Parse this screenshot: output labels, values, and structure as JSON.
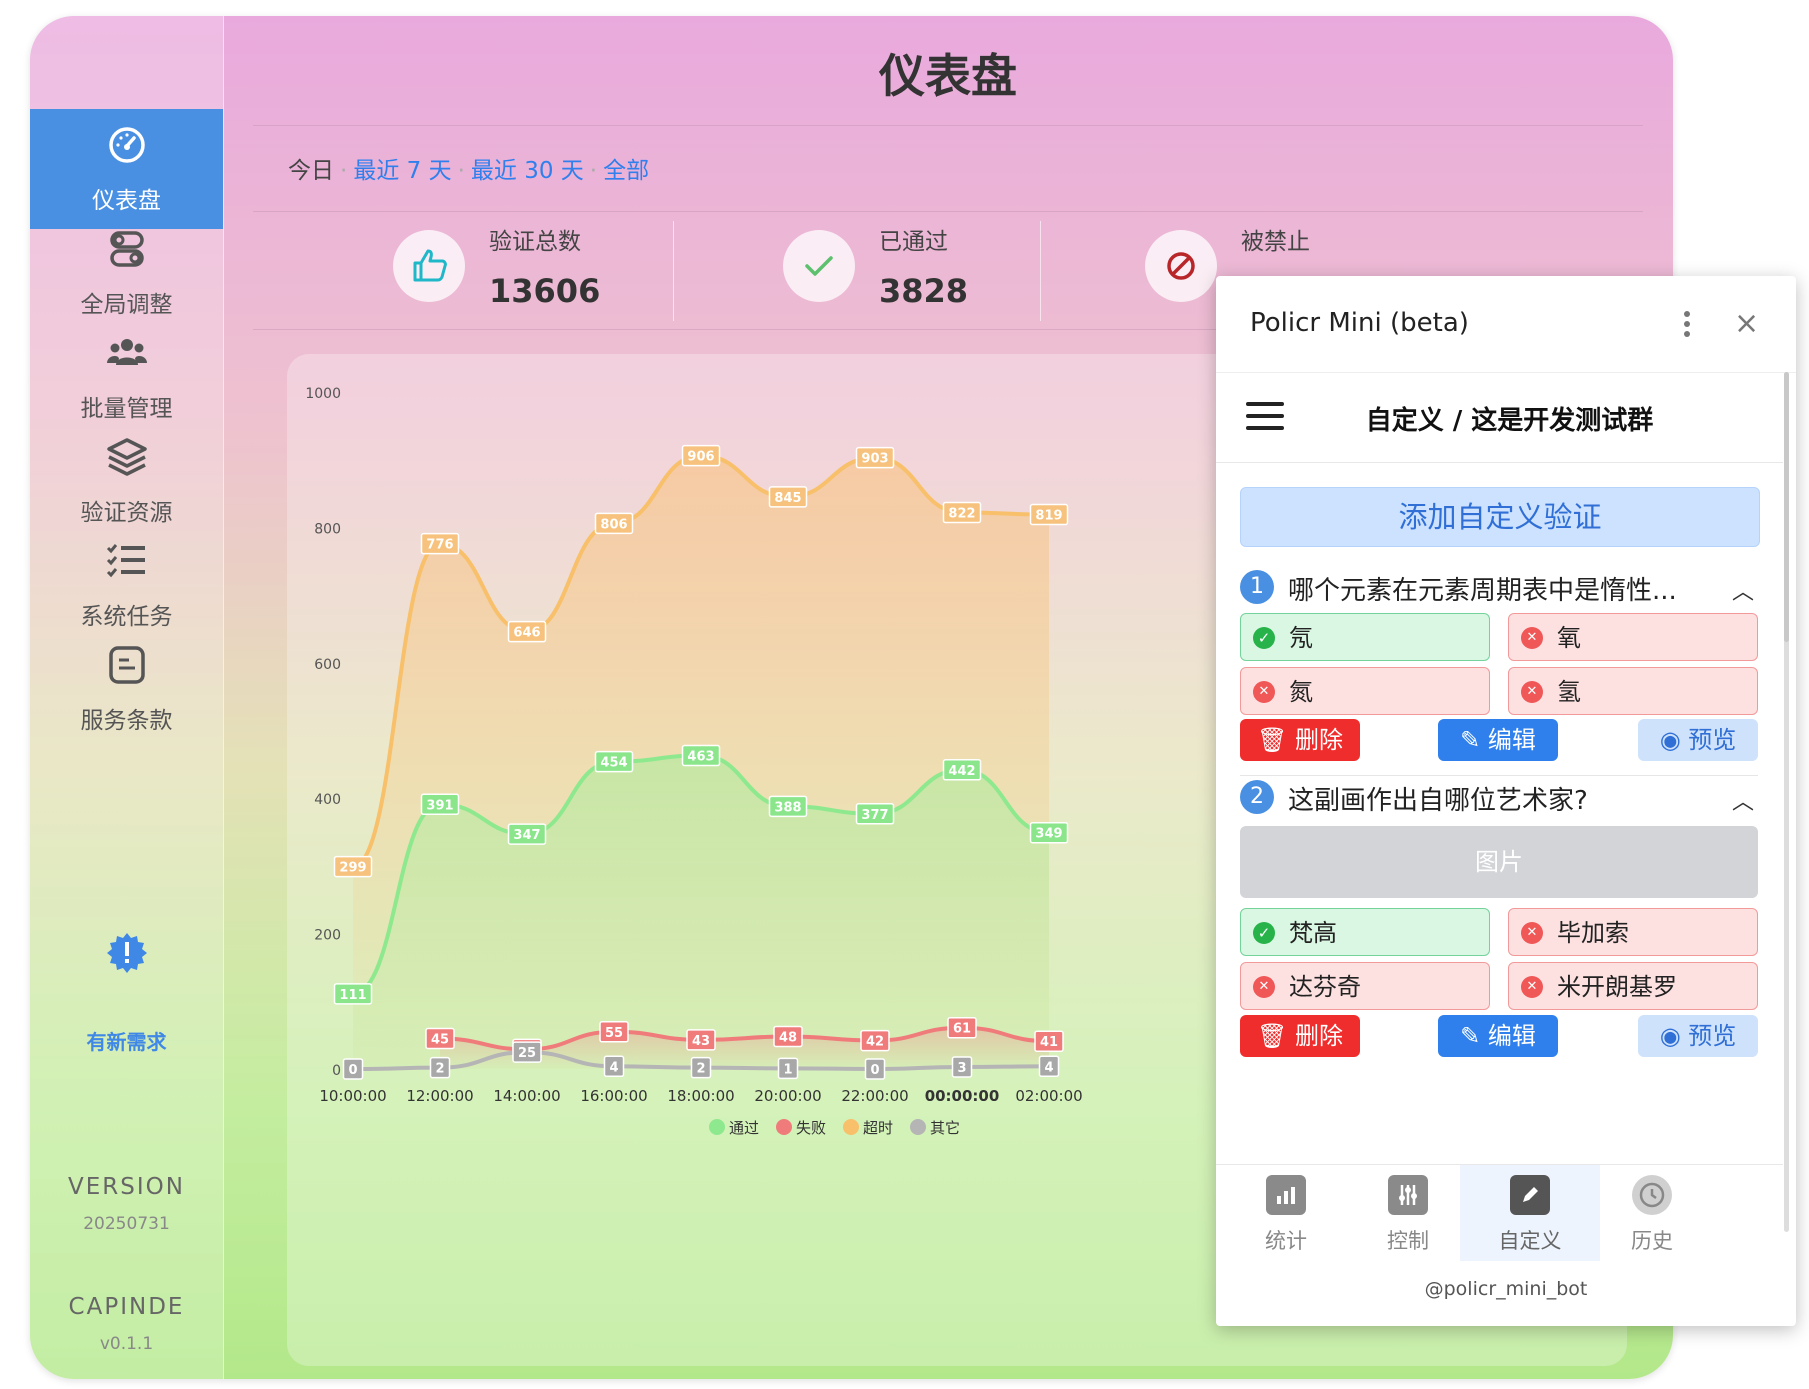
{
  "page_title": "仪表盘",
  "sidebar": {
    "items": [
      {
        "label": "仪表盘",
        "icon": "dashboard-icon"
      },
      {
        "label": "全局调整",
        "icon": "toggles-icon"
      },
      {
        "label": "批量管理",
        "icon": "users-icon"
      },
      {
        "label": "验证资源",
        "icon": "layers-icon"
      },
      {
        "label": "系统任务",
        "icon": "task-list-icon"
      },
      {
        "label": "服务条款",
        "icon": "terms-icon"
      }
    ],
    "new_request": "有新需求",
    "version_label": "VERSION",
    "version_value": "20250731",
    "capinde_label": "CAPINDE",
    "capinde_value": "v0.1.1"
  },
  "filters": {
    "today": "今日",
    "last7": "最近 7 天",
    "last30": "最近 30 天",
    "all": "全部"
  },
  "stats": [
    {
      "label": "验证总数",
      "value": "13606"
    },
    {
      "label": "已通过",
      "value": "3828"
    },
    {
      "label": "被禁止",
      "value": ""
    }
  ],
  "chart_data": {
    "type": "line",
    "x": [
      "10:00:00",
      "12:00:00",
      "14:00:00",
      "16:00:00",
      "18:00:00",
      "20:00:00",
      "22:00:00",
      "00:00:00",
      "02:00:00"
    ],
    "y_ticks": [
      "0",
      "200",
      "400",
      "600",
      "800",
      "1000"
    ],
    "ylim": [
      0,
      1000
    ],
    "legend_position": "bottom",
    "series": [
      {
        "name": "超时",
        "color": "#f8c06a",
        "values": [
          299,
          776,
          646,
          806,
          906,
          845,
          903,
          822,
          819
        ]
      },
      {
        "name": "通过",
        "color": "#8ee88e",
        "values": [
          111,
          391,
          347,
          454,
          463,
          388,
          377,
          442,
          349
        ]
      },
      {
        "name": "失败",
        "color": "#f07b7b",
        "values": [
          null,
          45,
          29,
          55,
          43,
          48,
          42,
          61,
          41
        ]
      },
      {
        "name": "其它",
        "color": "#b5b5b5",
        "values": [
          0,
          2,
          25,
          4,
          2,
          1,
          0,
          3,
          4
        ]
      }
    ]
  },
  "popup": {
    "title": "Policr Mini (beta)",
    "close": "×",
    "subtitle": "自定义 / 这是开发测试群",
    "add_button": "添加自定义验证",
    "questions": [
      {
        "num": "1",
        "text": "哪个元素在元素周期表中是惰性...",
        "options": [
          {
            "text": "氖",
            "correct": true
          },
          {
            "text": "氧",
            "correct": false
          },
          {
            "text": "氮",
            "correct": false
          },
          {
            "text": "氢",
            "correct": false
          }
        ]
      },
      {
        "num": "2",
        "text": "这副画作出自哪位艺术家?",
        "image_label": "图片",
        "options": [
          {
            "text": "梵高",
            "correct": true
          },
          {
            "text": "毕加索",
            "correct": false
          },
          {
            "text": "达芬奇",
            "correct": false
          },
          {
            "text": "米开朗基罗",
            "correct": false
          }
        ]
      }
    ],
    "actions": {
      "delete": "删除",
      "edit": "编辑",
      "preview": "预览"
    },
    "tabs": [
      {
        "label": "统计",
        "icon": "bar-chart-icon"
      },
      {
        "label": "控制",
        "icon": "sliders-icon"
      },
      {
        "label": "自定义",
        "icon": "edit-icon"
      },
      {
        "label": "历史",
        "icon": "history-icon"
      }
    ],
    "bot_name": "@policr_mini_bot"
  }
}
